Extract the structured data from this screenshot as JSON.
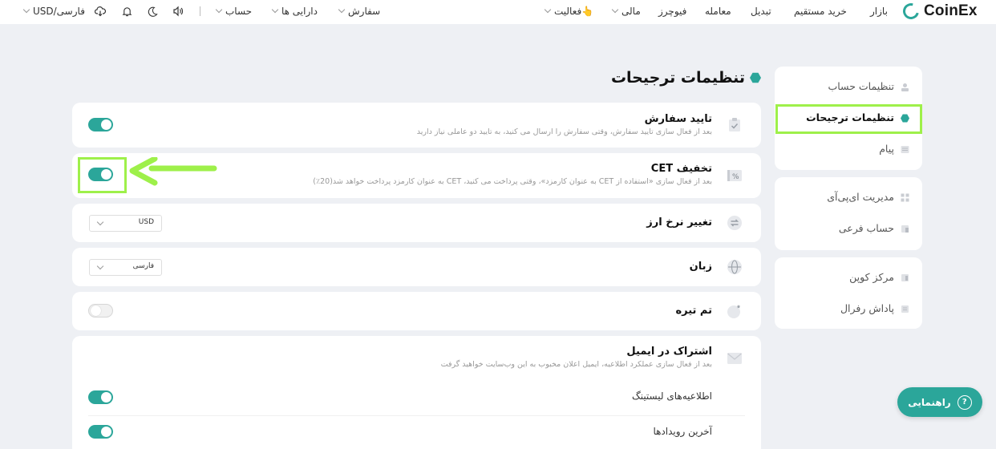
{
  "topbar": {
    "brand": "CoinEx",
    "nav": {
      "market": "بازار",
      "direct_buy": "خرید مستقیم",
      "convert": "تبدیل",
      "trade": "معامله",
      "futures": "فیوچرز",
      "finance": "مالی",
      "activity": "👆فعالیت"
    },
    "right": {
      "orders": "سفارش",
      "assets": "دارایی ها",
      "account": "حساب",
      "language_currency": "فارسی/USD"
    }
  },
  "page": {
    "title": "تنظیمات ترجیحات"
  },
  "settings": {
    "order_confirm": {
      "title": "تایید سفارش",
      "desc": "بعد از فعال سازی تایید سفارش، وقتی سفارش را ارسال می کنید، به تایید دو عاملی نیاز دارید",
      "enabled": true
    },
    "cet_discount": {
      "title": "تخفیف CET",
      "desc": "بعد از فعال سازی «استفاده از CET به عنوان کارمزد»، وقتی پرداخت می کنید، CET به عنوان کارمزد پرداخت خواهد شد(20٪)",
      "enabled": true
    },
    "currency": {
      "title": "تغییر نرخ ارز",
      "value": "USD"
    },
    "language": {
      "title": "زبان",
      "value": "فارسی"
    },
    "dark_theme": {
      "title": "تم تیره",
      "enabled": false
    },
    "email_subscription": {
      "title": "اشتراک در ایمیل",
      "desc": "بعد از فعال سازی عملکرد اطلاعیه، ایمیل اعلان مخبوب به این وب‌سایت خواهید گرفت",
      "items": [
        {
          "label": "اطلاعیه‌های لیستینگ",
          "enabled": true
        },
        {
          "label": "آخرین رویدادها",
          "enabled": true
        }
      ]
    }
  },
  "sidebar": {
    "group1": [
      {
        "label": "تنظیمات حساب",
        "icon": "user-icon"
      },
      {
        "label": "تنظیمات ترجیحات",
        "icon": "hexagon-icon",
        "active": true
      },
      {
        "label": "پیام",
        "icon": "message-icon"
      }
    ],
    "group2": [
      {
        "label": "مدیریت ای‌پی‌آی",
        "icon": "api-icon"
      },
      {
        "label": "حساب فرعی",
        "icon": "sub-account-icon"
      }
    ],
    "group3": [
      {
        "label": "مرکز کوپن",
        "icon": "coupon-icon"
      },
      {
        "label": "پاداش رفرال",
        "icon": "referral-icon"
      }
    ]
  },
  "help": {
    "label": "راهنمایی",
    "icon": "?"
  },
  "colors": {
    "accent": "#2ba69a",
    "highlight": "#9ef04a"
  }
}
